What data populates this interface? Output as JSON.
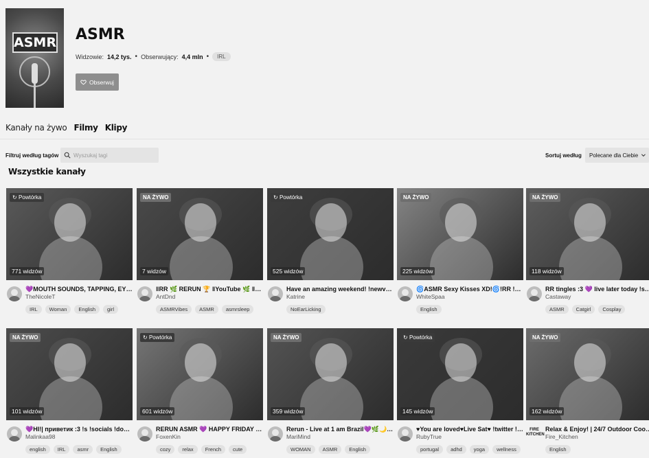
{
  "channel": {
    "cover_label": "ASMR",
    "title": "ASMR",
    "viewers_label": "Widzowie:",
    "viewers_value": "14,2 tys.",
    "followers_label": "Obserwujący:",
    "followers_value": "4,4 mln",
    "tag": "IRL",
    "follow_label": "Obserwuj"
  },
  "tabs": [
    {
      "label": "Kanały na żywo",
      "active": true
    },
    {
      "label": "Filmy",
      "active": false
    },
    {
      "label": "Klipy",
      "active": false
    }
  ],
  "filter": {
    "label": "Filtruj według tagów",
    "search_placeholder": "Wyszukaj tagi",
    "sort_label": "Sortuj według",
    "sort_value": "Polecane dla Ciebie"
  },
  "section_title": "Wszystkie kanały",
  "cards": [
    {
      "badge": "Powtórka",
      "badge_type": "replay",
      "viewers": "771 widzów",
      "title": "💜MOUTH SOUNDS, TAPPING, EYE C...",
      "channel": "TheNicoleT",
      "tags": [
        "IRL",
        "Woman",
        "English",
        "girl"
      ],
      "tone": "#5a5a5a"
    },
    {
      "badge": "NA ŻYWO",
      "badge_type": "live",
      "viewers": "7 widzów",
      "title": "‖RR 🌿 RERUN 🏆 ‖YouTube 🌿 ‖Red...",
      "channel": "AntDnd",
      "tags": [
        "ASMRVibes",
        "ASMR",
        "asmrsleep"
      ],
      "tone": "#4a4a4a"
    },
    {
      "badge": "Powtórka",
      "badge_type": "replay",
      "viewers": "525 widzów",
      "title": "Have an amazing weekend! !newvid o...",
      "channel": "Katrine",
      "tags": [
        "NoEarLicking"
      ],
      "tone": "#3e3e3e"
    },
    {
      "badge": "NA ŻYWO",
      "badge_type": "live",
      "viewers": "225 widzów",
      "title": "🌀ASMR Sexy Kisses XD!🌀!RR !s for ...",
      "channel": "WhiteSpaa",
      "tags": [
        "English"
      ],
      "tone": "#858585"
    },
    {
      "badge": "NA ŻYWO",
      "badge_type": "live",
      "viewers": "118 widzów",
      "title": "RR tingles :3 💜 live later today !s for ...",
      "channel": "Castaway",
      "tags": [
        "ASMR",
        "Catgirl",
        "Cosplay"
      ],
      "tone": "#5e5e5e"
    },
    {
      "badge": "NA ŻYWO",
      "badge_type": "live",
      "viewers": "101 widzów",
      "title": "💜HI!| приветик :3 !s !socials !donat...",
      "channel": "Malinkaa98",
      "tags": [
        "english",
        "IRL",
        "asmr",
        "English"
      ],
      "tone": "#4c4c4c"
    },
    {
      "badge": "Powtórka",
      "badge_type": "replay",
      "viewers": "601 widzów",
      "title": "RERUN ASMR 💜 HAPPY FRIDAY TIN...",
      "channel": "FoxenKin",
      "tags": [
        "cozy",
        "relax",
        "French",
        "cute"
      ],
      "tone": "#767676"
    },
    {
      "badge": "NA ŻYWO",
      "badge_type": "live",
      "viewers": "359 widzów",
      "title": "Rerun - Live at 1 am Brazil💜🌿🌙 !c...",
      "channel": "MariMind",
      "tags": [
        "WOMAN",
        "ASMR",
        "English"
      ],
      "tone": "#545454"
    },
    {
      "badge": "Powtórka",
      "badge_type": "replay",
      "viewers": "145 widzów",
      "title": "♥You are loved♥Live Sat♥ !twitter !i...",
      "channel": "RubyTrue",
      "tags": [
        "portugal",
        "adhd",
        "yoga",
        "wellness"
      ],
      "tone": "#3a3a3a"
    },
    {
      "badge": "NA ŻYWO",
      "badge_type": "live",
      "viewers": "162 widzów",
      "title": "Relax & Enjoy! | 24/7 Outdoor Cookin...",
      "channel": "Fire_Kitchen",
      "tags": [
        "English"
      ],
      "tone": "#6c6c6c"
    }
  ],
  "fire_icon_text": "FIRE KITCHEN",
  "colors": {
    "background": "#f2f2f2",
    "follow_button": "#8e8e8e",
    "live_badge": "#6e6e6e"
  }
}
